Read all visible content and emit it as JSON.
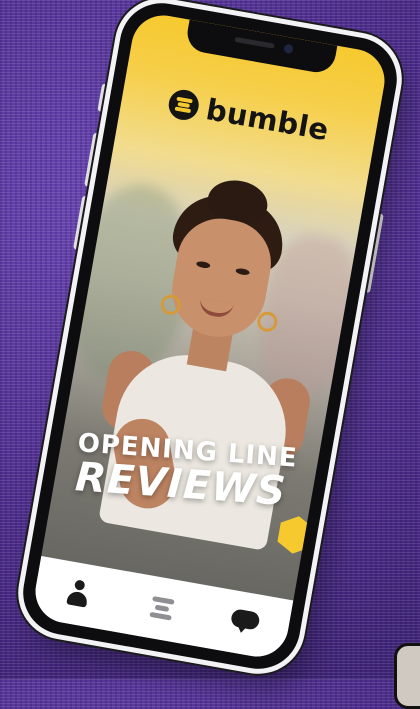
{
  "app": {
    "brand_name": "bumble",
    "accent_color": "#f6c92f",
    "background_color": "#5b3a9a"
  },
  "hero": {
    "title_line1": "OPENING LINE",
    "title_line2": "REVIEWS"
  },
  "nav": {
    "items": [
      {
        "icon": "profile-icon"
      },
      {
        "icon": "stack-icon"
      },
      {
        "icon": "chat-icon"
      }
    ]
  }
}
